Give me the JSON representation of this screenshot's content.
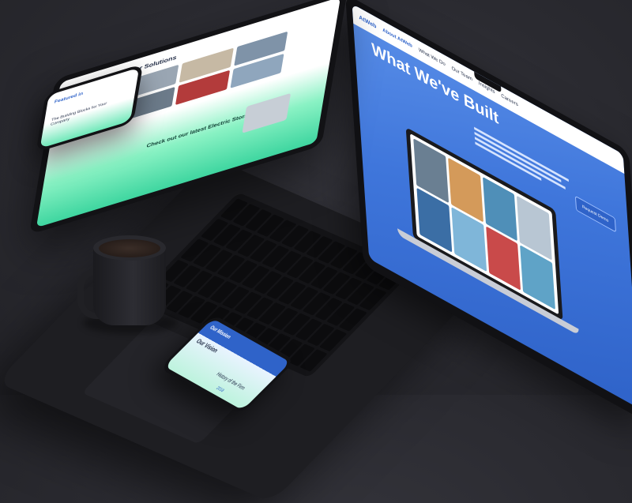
{
  "laptop": {
    "site_name": "AtWeb",
    "nav": [
      "About AtWeb",
      "What We Do",
      "Our Team",
      "Insights",
      "Careers"
    ],
    "heading": "What We've Built",
    "button_label": "Request Demo"
  },
  "tablet": {
    "title": "Our Solutions",
    "cta": "Check out our latest Electric Storage Solutions"
  },
  "phone_small": {
    "featured": "Featured in",
    "text": "The Building Blocks for Your Company"
  },
  "phone_front": {
    "mission": "Our Mission",
    "vision": "Our Vision",
    "history": "History of the Firm",
    "year": "2018"
  },
  "colors": {
    "brand_blue": "#2f63c9",
    "mint": "#3fd6a0",
    "background": "#2a2a30"
  }
}
